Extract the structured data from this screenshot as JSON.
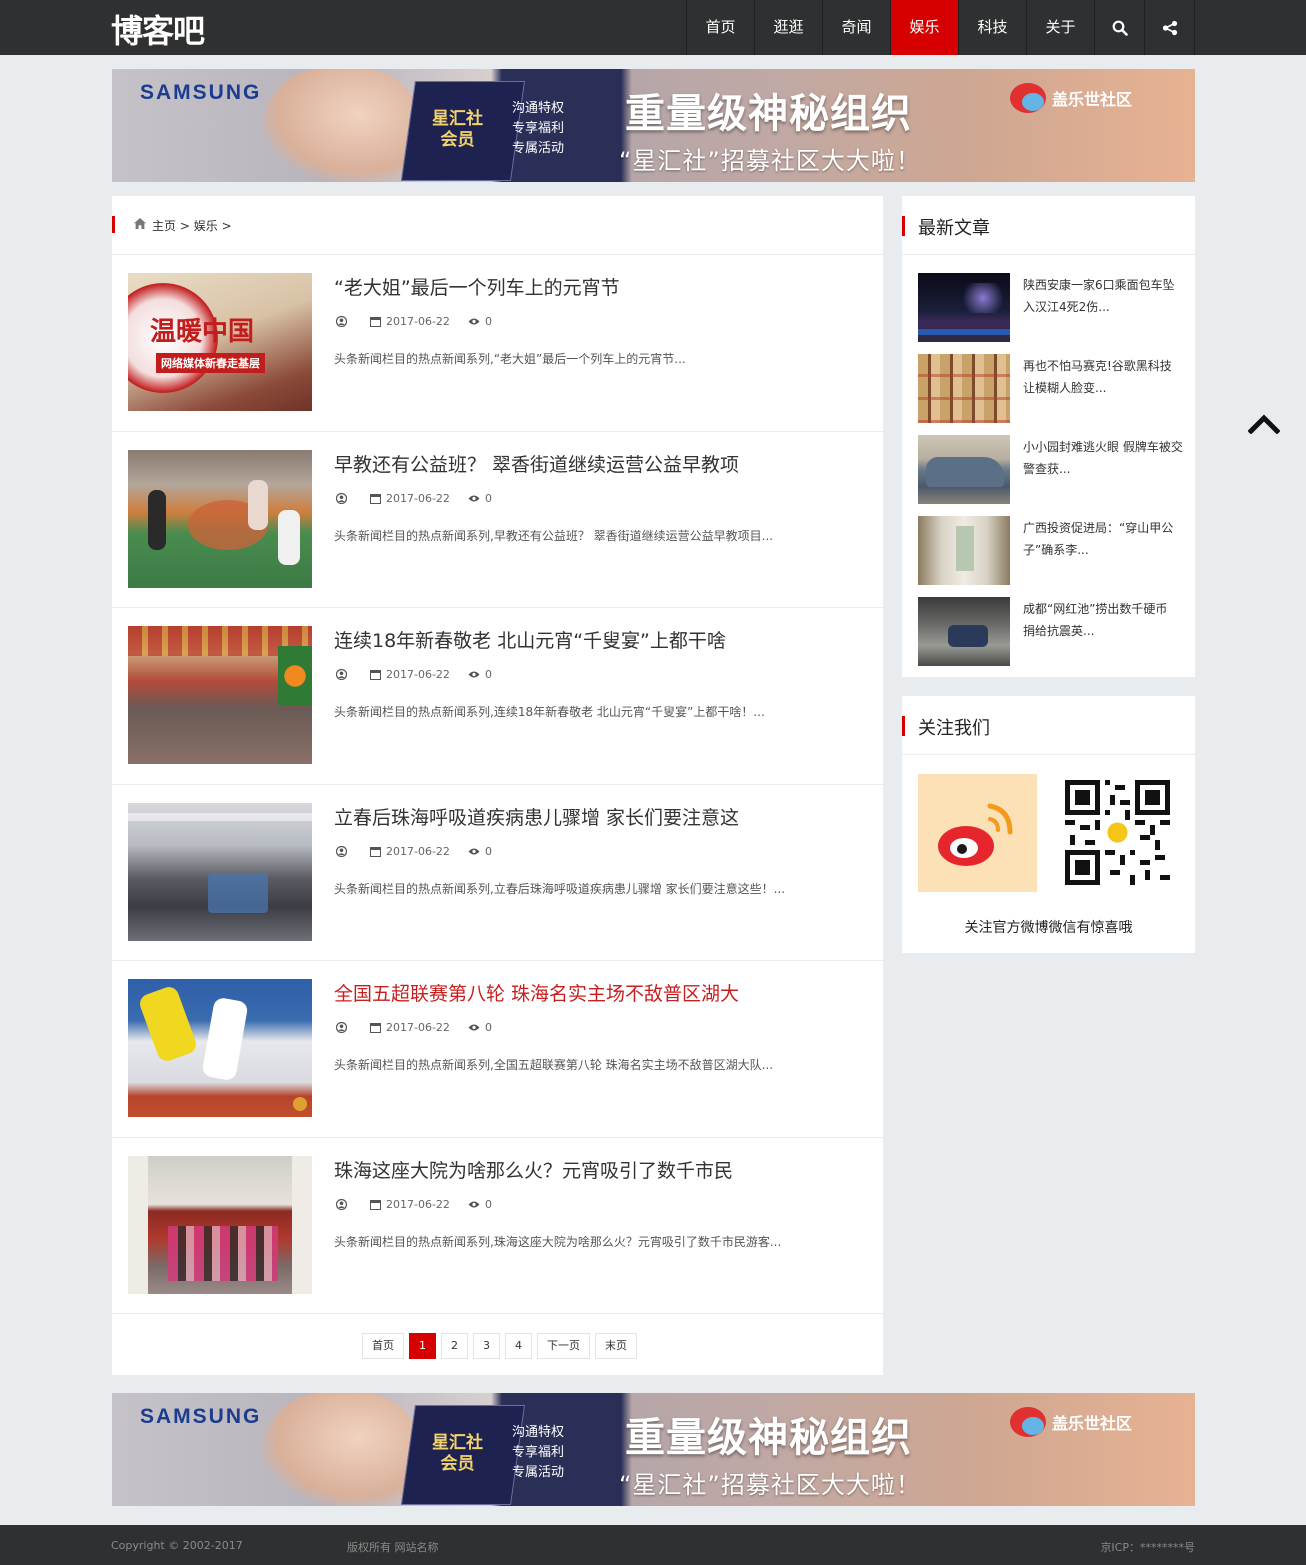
{
  "header": {
    "logo": "博客吧",
    "nav": [
      {
        "label": "首页",
        "active": false
      },
      {
        "label": "逛逛",
        "active": false
      },
      {
        "label": "奇闻",
        "active": false
      },
      {
        "label": "娱乐",
        "active": true
      },
      {
        "label": "科技",
        "active": false
      },
      {
        "label": "关于",
        "active": false
      }
    ],
    "icons": [
      "search-icon",
      "share-icon"
    ]
  },
  "banner": {
    "brand": "SAMSUNG",
    "card_text": "星汇社\n会员",
    "perks": [
      "沟通特权",
      "专享福利",
      "专属活动"
    ],
    "headline": "重量级神秘组织",
    "subline": "“星汇社”招募社区大大啦！",
    "community": "盖乐世社区"
  },
  "breadcrumb": {
    "home_icon": "home-icon",
    "home": "主页",
    "sep": ">",
    "current": "娱乐"
  },
  "articles": [
    {
      "title": "“老大姐”最后一个列车上的元宵节",
      "date": "2017-06-22",
      "views": "0",
      "excerpt": "头条新闻栏目的热点新闻系列,“老大姐”最后一个列车上的元宵节...",
      "highlight": false,
      "thumb_text": "温暖中国",
      "thumb_sub": "网络媒体新春走基层"
    },
    {
      "title": "早教还有公益班？ 翠香街道继续运营公益早教项",
      "date": "2017-06-22",
      "views": "0",
      "excerpt": "头条新闻栏目的热点新闻系列,早教还有公益班？ 翠香街道继续运营公益早教项目...",
      "highlight": false
    },
    {
      "title": "连续18年新春敬老 北山元宵“千叟宴”上都干啥",
      "date": "2017-06-22",
      "views": "0",
      "excerpt": "头条新闻栏目的热点新闻系列,连续18年新春敬老 北山元宵“千叟宴”上都干啥！...",
      "highlight": false
    },
    {
      "title": "立春后珠海呼吸道疾病患儿骤增 家长们要注意这",
      "date": "2017-06-22",
      "views": "0",
      "excerpt": "头条新闻栏目的热点新闻系列,立春后珠海呼吸道疾病患儿骤增 家长们要注意这些！...",
      "highlight": false
    },
    {
      "title": "全国五超联赛第八轮 珠海名实主场不敌普区湖大",
      "date": "2017-06-22",
      "views": "0",
      "excerpt": "头条新闻栏目的热点新闻系列,全国五超联赛第八轮 珠海名实主场不敌普区湖大队...",
      "highlight": true
    },
    {
      "title": "珠海这座大院为啥那么火？元宵吸引了数千市民",
      "date": "2017-06-22",
      "views": "0",
      "excerpt": "头条新闻栏目的热点新闻系列,珠海这座大院为啥那么火？元宵吸引了数千市民游客...",
      "highlight": false
    }
  ],
  "pagination": {
    "first": "首页",
    "pages": [
      "1",
      "2",
      "3",
      "4"
    ],
    "current": "1",
    "next": "下一页",
    "last": "末页"
  },
  "sidebar": {
    "latest_title": "最新文章",
    "latest": [
      {
        "title": "陕西安康一家6口乘面包车坠入汉江4死2伤..."
      },
      {
        "title": "再也不怕马赛克!谷歌黑科技让模糊人脸变..."
      },
      {
        "title": "小小园封难逃火眼 假牌车被交警查获..."
      },
      {
        "title": "广西投资促进局：“穿山甲公子”确系李..."
      },
      {
        "title": "成都“网红池”捞出数千硬币 捐给抗震英..."
      }
    ],
    "follow_title": "关注我们",
    "follow_caption": "关注官方微博微信有惊喜哦"
  },
  "footer": {
    "copyright": "Copyright © 2002-2017",
    "rights": "版权所有 网站名称",
    "icp": "京ICP：********号"
  },
  "colors": {
    "accent": "#d60000",
    "header_bg": "#2f3031",
    "page_bg": "#e9ecef",
    "highlight_title": "#c81e1e"
  }
}
